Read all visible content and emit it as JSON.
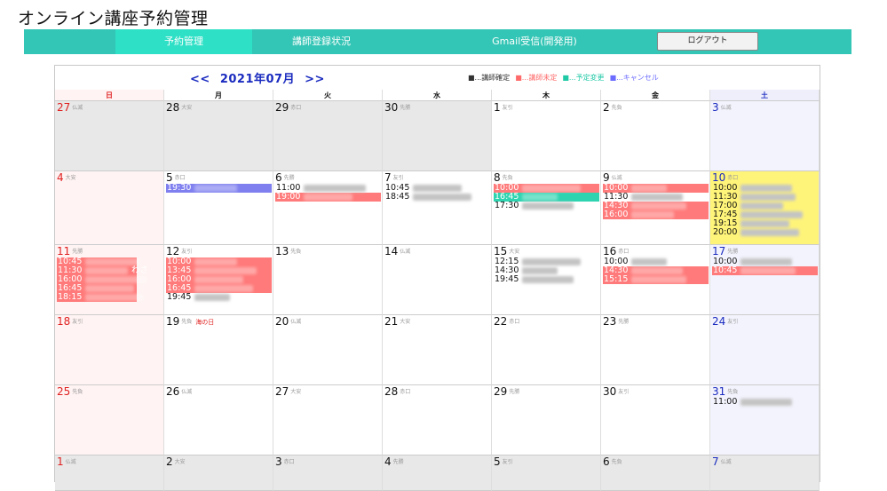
{
  "app": {
    "title": "オンライン講座予約管理"
  },
  "nav": {
    "items": [
      {
        "label": "予約管理",
        "active": true
      },
      {
        "label": "講師登録状況",
        "active": false
      },
      {
        "label": "Gmail受信(開発用)",
        "active": false
      }
    ],
    "logout_label": "ログアウト"
  },
  "calendar": {
    "prev_label": "<<",
    "month_label": "2021年07月",
    "next_label": ">>",
    "legend": [
      {
        "label": "■...講師確定",
        "color": "#333333"
      },
      {
        "label": "■...講師未定",
        "color": "#ff6b6b"
      },
      {
        "label": "■...予定変更",
        "color": "#20c9a6"
      },
      {
        "label": "■...キャンセル",
        "color": "#6b6bff"
      }
    ],
    "weekdays": [
      {
        "label": "日",
        "color": "#e02020",
        "bg": "#fff3f3"
      },
      {
        "label": "月",
        "color": "#111111",
        "bg": "#ffffff"
      },
      {
        "label": "火",
        "color": "#111111",
        "bg": "#ffffff"
      },
      {
        "label": "水",
        "color": "#111111",
        "bg": "#ffffff"
      },
      {
        "label": "木",
        "color": "#111111",
        "bg": "#ffffff"
      },
      {
        "label": "金",
        "color": "#111111",
        "bg": "#ffffff"
      },
      {
        "label": "土",
        "color": "#1a2bbf",
        "bg": "#efeffc"
      }
    ],
    "colors": {
      "confirmed": "#111111",
      "undecided": "#ff7a7a",
      "changed": "#2ed3b0",
      "cancelled": "#7f7ff0",
      "today": "#fff47a",
      "outside": "#e8e8e8",
      "sunday": "#fff3f3",
      "saturday": "#f3f3fd"
    },
    "weeks": [
      [
        {
          "day": "27",
          "rokuyo": "仏滅",
          "outside": true,
          "events": []
        },
        {
          "day": "28",
          "rokuyo": "大安",
          "outside": true,
          "events": []
        },
        {
          "day": "29",
          "rokuyo": "赤口",
          "outside": true,
          "events": []
        },
        {
          "day": "30",
          "rokuyo": "先勝",
          "outside": true,
          "events": []
        },
        {
          "day": "1",
          "rokuyo": "友引",
          "events": []
        },
        {
          "day": "2",
          "rokuyo": "先負",
          "events": []
        },
        {
          "day": "3",
          "rokuyo": "仏滅",
          "events": []
        }
      ],
      [
        {
          "day": "4",
          "rokuyo": "大安",
          "events": []
        },
        {
          "day": "5",
          "rokuyo": "赤口",
          "events": [
            {
              "time": "19:30",
              "status": "cancelled"
            }
          ]
        },
        {
          "day": "6",
          "rokuyo": "先勝",
          "events": [
            {
              "time": "11:00",
              "status": "confirmed"
            },
            {
              "time": "19:00",
              "status": "undecided"
            }
          ]
        },
        {
          "day": "7",
          "rokuyo": "友引",
          "events": [
            {
              "time": "10:45",
              "status": "confirmed"
            },
            {
              "time": "18:45",
              "status": "confirmed"
            }
          ]
        },
        {
          "day": "8",
          "rokuyo": "先負",
          "events": [
            {
              "time": "10:00",
              "status": "undecided"
            },
            {
              "time": "16:45",
              "status": "changed"
            },
            {
              "time": "17:30",
              "status": "confirmed"
            }
          ]
        },
        {
          "day": "9",
          "rokuyo": "仏滅",
          "events": [
            {
              "time": "10:00",
              "status": "undecided"
            },
            {
              "time": "11:30",
              "status": "confirmed"
            },
            {
              "time": "14:30",
              "status": "undecided"
            },
            {
              "time": "16:00",
              "status": "undecided"
            }
          ]
        },
        {
          "day": "10",
          "rokuyo": "赤口",
          "today": true,
          "events": [
            {
              "time": "10:00",
              "status": "confirmed"
            },
            {
              "time": "11:30",
              "status": "confirmed"
            },
            {
              "time": "17:00",
              "status": "confirmed"
            },
            {
              "time": "17:45",
              "status": "confirmed"
            },
            {
              "time": "19:15",
              "status": "confirmed"
            },
            {
              "time": "20:00",
              "status": "confirmed"
            }
          ]
        }
      ],
      [
        {
          "day": "11",
          "rokuyo": "先勝",
          "events": [
            {
              "time": "10:45",
              "status": "undecided",
              "extra": ""
            },
            {
              "time": "11:30",
              "status": "undecided",
              "extra": "わさ"
            },
            {
              "time": "16:00",
              "status": "undecided"
            },
            {
              "time": "16:45",
              "status": "undecided"
            },
            {
              "time": "18:15",
              "status": "undecided"
            }
          ]
        },
        {
          "day": "12",
          "rokuyo": "友引",
          "events": [
            {
              "time": "10:00",
              "status": "undecided"
            },
            {
              "time": "13:45",
              "status": "undecided"
            },
            {
              "time": "16:00",
              "status": "undecided"
            },
            {
              "time": "16:45",
              "status": "undecided"
            },
            {
              "time": "19:45",
              "status": "confirmed"
            }
          ]
        },
        {
          "day": "13",
          "rokuyo": "先負",
          "events": []
        },
        {
          "day": "14",
          "rokuyo": "仏滅",
          "events": []
        },
        {
          "day": "15",
          "rokuyo": "大安",
          "events": [
            {
              "time": "12:15",
              "status": "confirmed"
            },
            {
              "time": "14:30",
              "status": "confirmed"
            },
            {
              "time": "19:45",
              "status": "confirmed"
            }
          ]
        },
        {
          "day": "16",
          "rokuyo": "赤口",
          "events": [
            {
              "time": "10:00",
              "status": "confirmed"
            },
            {
              "time": "14:30",
              "status": "undecided"
            },
            {
              "time": "15:15",
              "status": "undecided"
            }
          ]
        },
        {
          "day": "17",
          "rokuyo": "先勝",
          "events": [
            {
              "time": "10:00",
              "status": "confirmed"
            },
            {
              "time": "10:45",
              "status": "undecided"
            }
          ]
        }
      ],
      [
        {
          "day": "18",
          "rokuyo": "友引",
          "events": []
        },
        {
          "day": "19",
          "rokuyo": "先負",
          "holiday": "海の日",
          "events": []
        },
        {
          "day": "20",
          "rokuyo": "仏滅",
          "events": []
        },
        {
          "day": "21",
          "rokuyo": "大安",
          "events": []
        },
        {
          "day": "22",
          "rokuyo": "赤口",
          "events": []
        },
        {
          "day": "23",
          "rokuyo": "先勝",
          "events": []
        },
        {
          "day": "24",
          "rokuyo": "友引",
          "events": []
        }
      ],
      [
        {
          "day": "25",
          "rokuyo": "先負",
          "events": []
        },
        {
          "day": "26",
          "rokuyo": "仏滅",
          "events": []
        },
        {
          "day": "27",
          "rokuyo": "大安",
          "events": []
        },
        {
          "day": "28",
          "rokuyo": "赤口",
          "events": []
        },
        {
          "day": "29",
          "rokuyo": "先勝",
          "events": []
        },
        {
          "day": "30",
          "rokuyo": "友引",
          "events": []
        },
        {
          "day": "31",
          "rokuyo": "先負",
          "events": [
            {
              "time": "11:00",
              "status": "confirmed"
            }
          ]
        }
      ],
      [
        {
          "day": "1",
          "rokuyo": "仏滅",
          "outside": true,
          "events": []
        },
        {
          "day": "2",
          "rokuyo": "大安",
          "outside": true,
          "events": []
        },
        {
          "day": "3",
          "rokuyo": "赤口",
          "outside": true,
          "events": []
        },
        {
          "day": "4",
          "rokuyo": "先勝",
          "outside": true,
          "events": []
        },
        {
          "day": "5",
          "rokuyo": "友引",
          "outside": true,
          "events": []
        },
        {
          "day": "6",
          "rokuyo": "先負",
          "outside": true,
          "events": []
        },
        {
          "day": "7",
          "rokuyo": "仏滅",
          "outside": true,
          "events": []
        }
      ]
    ]
  }
}
